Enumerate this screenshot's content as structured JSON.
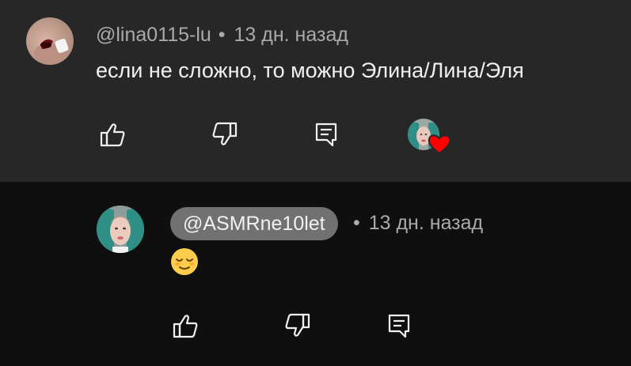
{
  "parent_comment": {
    "author": "@lina0115-lu",
    "separator": "•",
    "time": "13 дн. назад",
    "text": "если не сложно, то можно Элина/Лина/Эля",
    "actions": {
      "like": "like-icon",
      "dislike": "dislike-icon",
      "reply": "reply-icon",
      "creator_heart": "creator-heart"
    },
    "heart_color": "#ff0000"
  },
  "reply_comment": {
    "author": "@ASMRne10let",
    "separator": "•",
    "time": "13 дн. назад",
    "emoji": "relieved-face-emoji",
    "actions": {
      "like": "like-icon",
      "dislike": "dislike-icon",
      "reply": "reply-icon"
    }
  },
  "colors": {
    "parent_bg": "#272727",
    "reply_bg": "#0f0f0f",
    "text_primary": "#f1f1f1",
    "text_secondary": "#aaaaaa",
    "handle_pill": "#717171"
  }
}
